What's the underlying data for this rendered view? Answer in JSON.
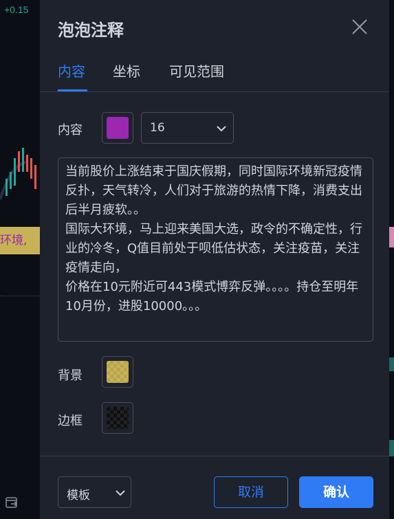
{
  "background": {
    "price_change": "+0.15",
    "bubble_text": "环境,"
  },
  "dialog": {
    "title": "泡泡注释",
    "tabs": [
      {
        "label": "内容",
        "active": true
      },
      {
        "label": "坐标",
        "active": false
      },
      {
        "label": "可见范围",
        "active": false
      }
    ],
    "content": {
      "label": "内容",
      "text_color": "#9c27b0",
      "font_size": "16",
      "text": "当前股价上涨结束于国庆假期，同时国际环境新冠疫情反扑，天气转冷，人们对于旅游的热情下降，消费支出后半月疲软。。\n国际大环境，马上迎来美国大选，政令的不确定性，行业的冷冬，Q值目前处于呗低估状态，关注疫苗，关注疫情走向，\n价格在10元附近可443模式博弈反弹。。。。持仓至明年10月份，进股10000。。。"
    },
    "background": {
      "label": "背景",
      "color": "#c8b257"
    },
    "border": {
      "label": "边框",
      "color": "transparent"
    },
    "footer": {
      "template_label": "模板",
      "cancel_label": "取消",
      "ok_label": "确认"
    },
    "colors": {
      "accent": "#2f7bf5",
      "panel": "#1e222d",
      "text": "#d1d4dc"
    }
  }
}
